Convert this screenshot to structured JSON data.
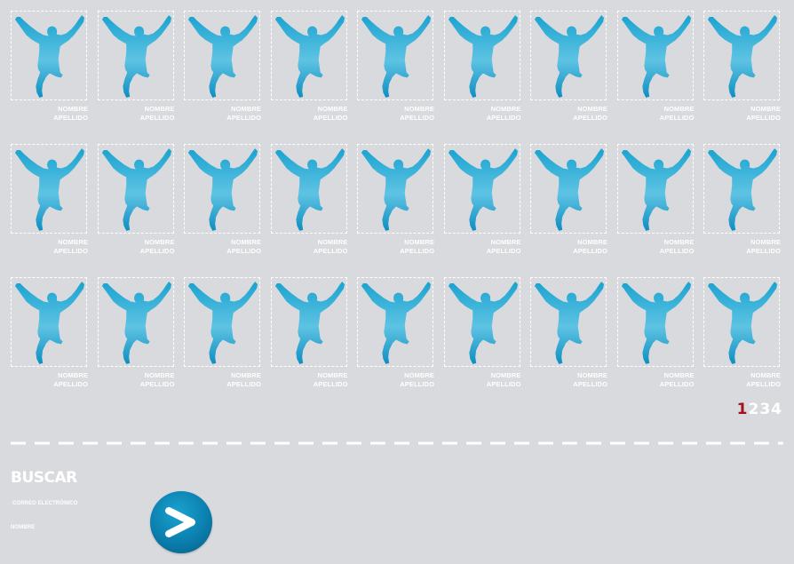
{
  "players": [
    {
      "first_name": "NOMBRE",
      "last_name": "APELLIDO"
    },
    {
      "first_name": "NOMBRE",
      "last_name": "APELLIDO"
    },
    {
      "first_name": "NOMBRE",
      "last_name": "APELLIDO"
    },
    {
      "first_name": "NOMBRE",
      "last_name": "APELLIDO"
    },
    {
      "first_name": "NOMBRE",
      "last_name": "APELLIDO"
    },
    {
      "first_name": "NOMBRE",
      "last_name": "APELLIDO"
    },
    {
      "first_name": "NOMBRE",
      "last_name": "APELLIDO"
    },
    {
      "first_name": "NOMBRE",
      "last_name": "APELLIDO"
    },
    {
      "first_name": "NOMBRE",
      "last_name": "APELLIDO"
    },
    {
      "first_name": "NOMBRE",
      "last_name": "APELLIDO"
    },
    {
      "first_name": "NOMBRE",
      "last_name": "APELLIDO"
    },
    {
      "first_name": "NOMBRE",
      "last_name": "APELLIDO"
    },
    {
      "first_name": "NOMBRE",
      "last_name": "APELLIDO"
    },
    {
      "first_name": "NOMBRE",
      "last_name": "APELLIDO"
    },
    {
      "first_name": "NOMBRE",
      "last_name": "APELLIDO"
    },
    {
      "first_name": "NOMBRE",
      "last_name": "APELLIDO"
    },
    {
      "first_name": "NOMBRE",
      "last_name": "APELLIDO"
    },
    {
      "first_name": "NOMBRE",
      "last_name": "APELLIDO"
    },
    {
      "first_name": "NOMBRE",
      "last_name": "APELLIDO"
    },
    {
      "first_name": "NOMBRE",
      "last_name": "APELLIDO"
    },
    {
      "first_name": "NOMBRE",
      "last_name": "APELLIDO"
    },
    {
      "first_name": "NOMBRE",
      "last_name": "APELLIDO"
    },
    {
      "first_name": "NOMBRE",
      "last_name": "APELLIDO"
    },
    {
      "first_name": "NOMBRE",
      "last_name": "APELLIDO"
    },
    {
      "first_name": "NOMBRE",
      "last_name": "APELLIDO"
    },
    {
      "first_name": "NOMBRE",
      "last_name": "APELLIDO"
    },
    {
      "first_name": "NOMBRE",
      "last_name": "APELLIDO"
    }
  ],
  "player_icon": "player-silhouette-icon",
  "pagination": {
    "pages": [
      "1",
      "2",
      "3",
      "4"
    ],
    "current": "1"
  },
  "search": {
    "title": "BUSCAR",
    "email_label": "CORREO ELECTRÓNICO",
    "name_label": "NOMBRE",
    "submit_icon": "chevron-right-icon"
  },
  "colors": {
    "background": "#d9dadd",
    "accent": "#1aa3d0",
    "active_page": "#a3121c",
    "text": "#ffffff"
  }
}
